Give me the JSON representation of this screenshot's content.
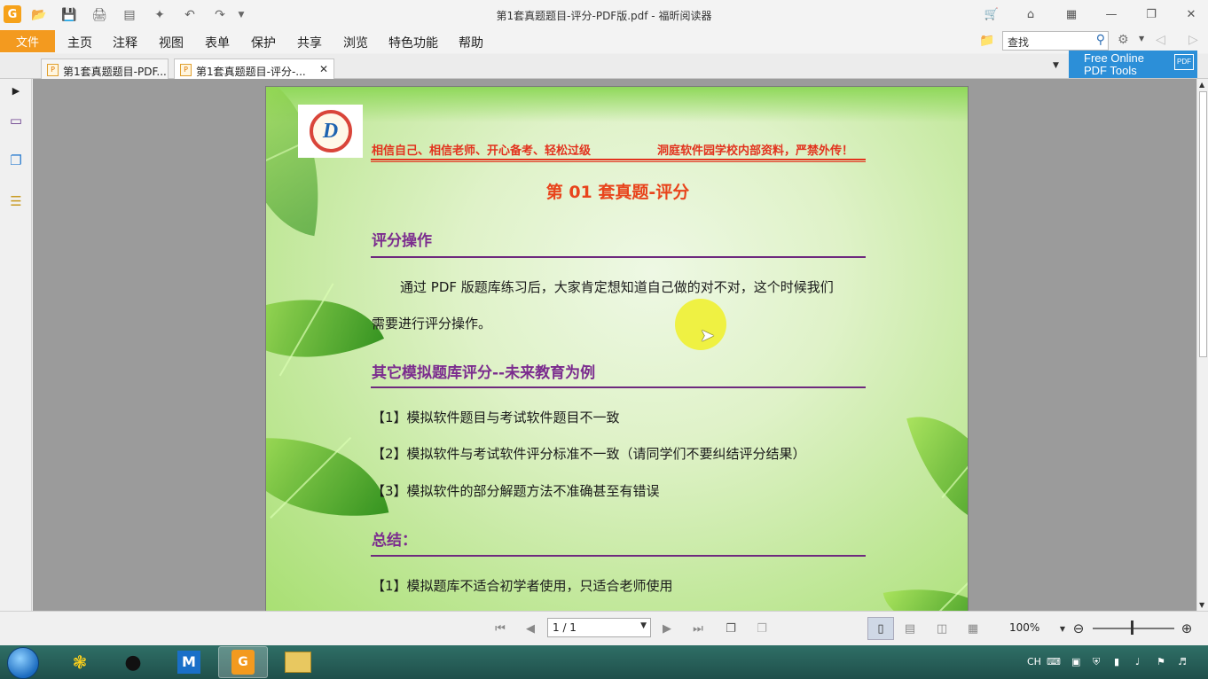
{
  "window": {
    "title": "第1套真题题目-评分-PDF版.pdf - 福昕阅读器"
  },
  "menu": {
    "file": "文件",
    "items": [
      "主页",
      "注释",
      "视图",
      "表单",
      "保护",
      "共享",
      "浏览",
      "特色功能",
      "帮助"
    ]
  },
  "search": {
    "value": "查找"
  },
  "tabs": [
    {
      "label": "第1套真题题目-PDF..."
    },
    {
      "label": "第1套真题题目-评分-..."
    }
  ],
  "promo": {
    "line1": "Free Online",
    "line2": "PDF Tools",
    "badge": "PDF"
  },
  "document": {
    "slogan_left": "相信自己、相信老师、开心备考、轻松过级",
    "slogan_right": "洞庭软件园学校内部资料，严禁外传！",
    "title": "第 01 套真题-评分",
    "logo_letter": "D",
    "section1": {
      "heading": "评分操作",
      "line1": "通过 PDF 版题库练习后，大家肯定想知道自己做的对不对，这个时候我们",
      "line2": "需要进行评分操作。"
    },
    "section2": {
      "heading": "其它模拟题库评分--未来教育为例",
      "items": [
        "【1】模拟软件题目与考试软件题目不一致",
        "【2】模拟软件与考试软件评分标准不一致（请同学们不要纠结评分结果）",
        "【3】模拟软件的部分解题方法不准确甚至有错误"
      ]
    },
    "section3": {
      "heading": "总结：",
      "items": [
        "【1】模拟题库不适合初学者使用，只适合老师使用"
      ]
    }
  },
  "statusbar": {
    "page": "1 / 1",
    "zoom": "100%"
  },
  "taskbar": {
    "tray_lang": "CH"
  },
  "colors": {
    "accent": "#f39a1f",
    "title_red": "#e8441c",
    "heading_purple": "#7b2c8e",
    "promo_blue": "#2c8fd8"
  }
}
